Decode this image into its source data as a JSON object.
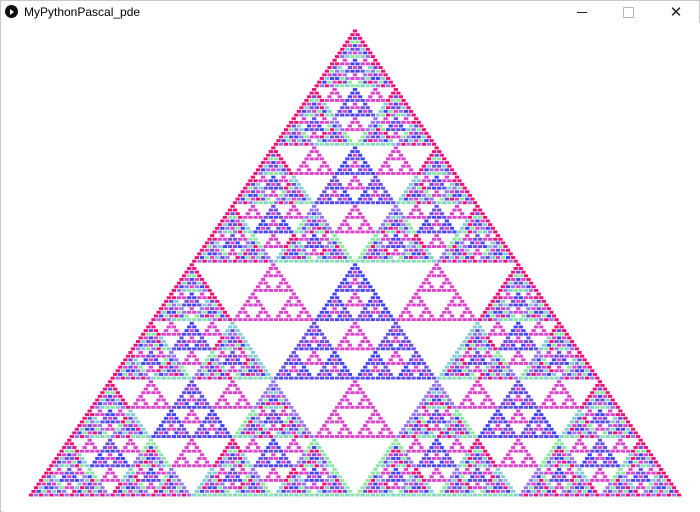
{
  "window": {
    "title": "MyPythonPascal_pde",
    "minimize_glyph": "—",
    "maximize_glyph": "□",
    "close_glyph": "✕"
  },
  "sketch": {
    "rows": 128,
    "palette": [
      "#e6dedb",
      "#ee1177",
      "#6a4fe0",
      "#8ee6a4",
      "#dd44cc",
      "#88ccd4",
      "#4444ff",
      "#9977ee"
    ]
  }
}
